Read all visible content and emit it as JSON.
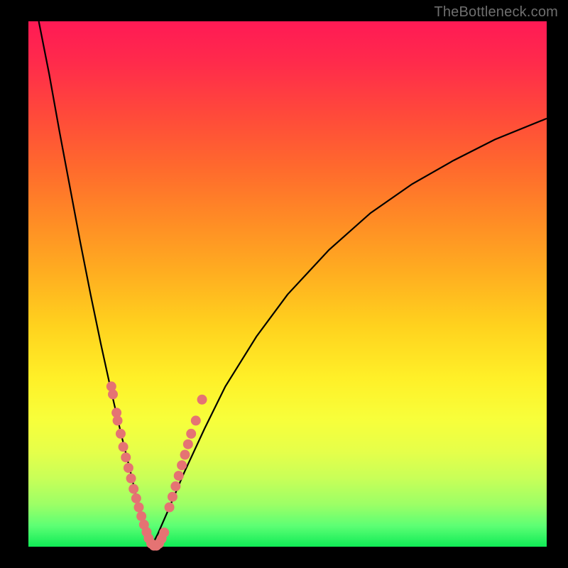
{
  "watermark": "TheBottleneck.com",
  "colors": {
    "point_fill": "#e57373",
    "curve_stroke": "#000000"
  },
  "chart_data": {
    "type": "line",
    "title": "",
    "xlabel": "",
    "ylabel": "",
    "xlim": [
      0,
      100
    ],
    "ylim": [
      0,
      100
    ],
    "curves": [
      {
        "name": "left-arm",
        "x": [
          2,
          4,
          6,
          8,
          10,
          12,
          14,
          16,
          18,
          20,
          21,
          22,
          23,
          23.7
        ],
        "y": [
          100,
          90,
          79,
          68.5,
          58,
          48,
          38.5,
          29.5,
          21,
          13,
          8.5,
          5,
          2,
          0
        ]
      },
      {
        "name": "right-arm",
        "x": [
          23.7,
          25,
          27,
          30,
          34,
          38,
          44,
          50,
          58,
          66,
          74,
          82,
          90,
          100
        ],
        "y": [
          0,
          2.5,
          7,
          14,
          22.5,
          30.5,
          40,
          48,
          56.5,
          63.5,
          69,
          73.5,
          77.5,
          81.5
        ]
      }
    ],
    "points": [
      {
        "name": "left-cluster",
        "coords": [
          [
            16.0,
            30.5
          ],
          [
            16.3,
            29.0
          ],
          [
            17.0,
            25.5
          ],
          [
            17.2,
            24.0
          ],
          [
            17.8,
            21.5
          ],
          [
            18.3,
            19.0
          ],
          [
            18.8,
            17.0
          ],
          [
            19.3,
            15.0
          ],
          [
            19.8,
            13.0
          ],
          [
            20.3,
            11.0
          ],
          [
            20.8,
            9.2
          ],
          [
            21.3,
            7.5
          ],
          [
            21.8,
            5.8
          ],
          [
            22.3,
            4.2
          ],
          [
            22.8,
            2.8
          ],
          [
            23.2,
            1.6
          ],
          [
            23.7,
            0.6
          ],
          [
            24.2,
            0.2
          ],
          [
            24.7,
            0.2
          ],
          [
            25.2,
            0.6
          ],
          [
            25.7,
            1.5
          ],
          [
            26.2,
            2.7
          ]
        ]
      },
      {
        "name": "right-cluster",
        "coords": [
          [
            27.2,
            7.5
          ],
          [
            27.8,
            9.5
          ],
          [
            28.4,
            11.5
          ],
          [
            29.0,
            13.5
          ],
          [
            29.6,
            15.5
          ],
          [
            30.2,
            17.5
          ],
          [
            30.8,
            19.5
          ],
          [
            31.4,
            21.5
          ],
          [
            32.3,
            24.0
          ],
          [
            33.5,
            28.0
          ]
        ]
      }
    ]
  }
}
